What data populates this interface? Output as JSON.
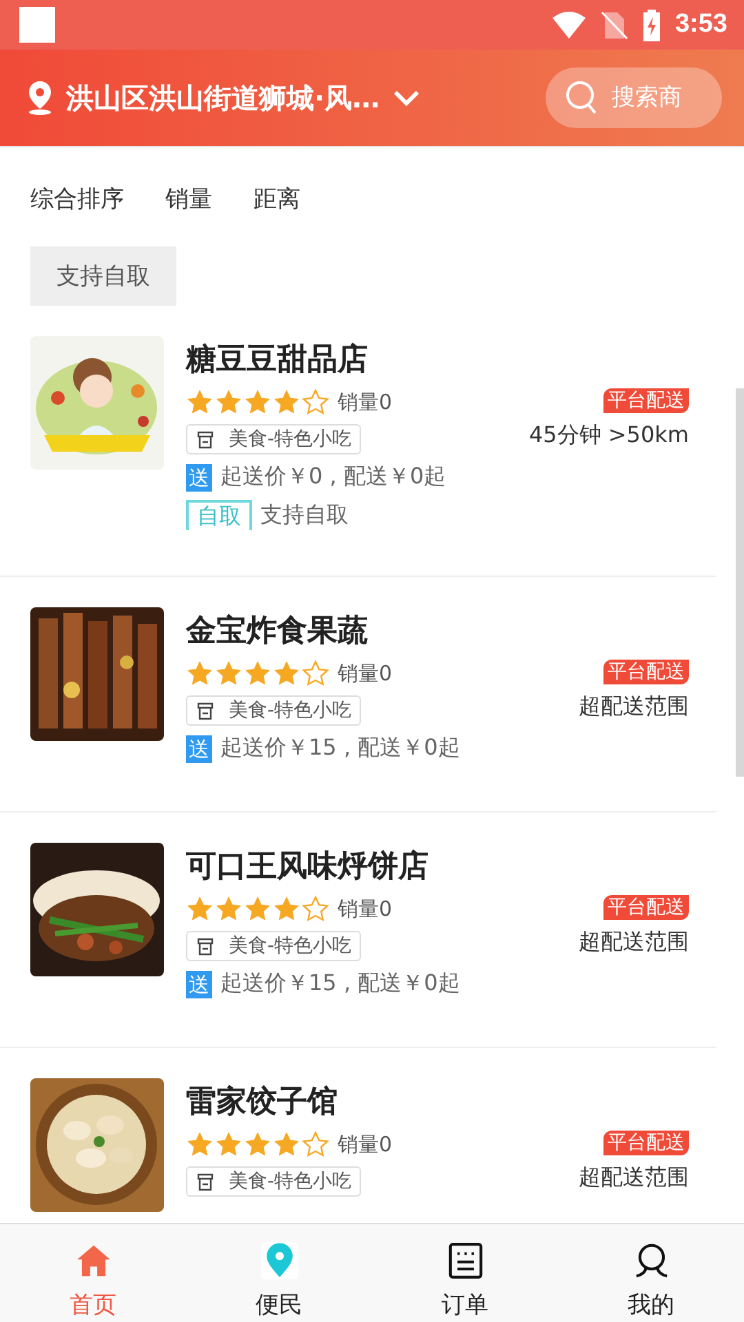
{
  "status_bar": {
    "time": "3:53"
  },
  "header": {
    "location": "洪山区洪山街道狮城·风…",
    "search": {
      "placeholder": "搜索商"
    }
  },
  "sort_tabs": [
    {
      "label": "综合排序",
      "selected": false
    },
    {
      "label": "销量",
      "selected": false
    },
    {
      "label": "距离",
      "selected": false
    }
  ],
  "filter_chips": [
    {
      "label": "支持自取",
      "selected": false
    }
  ],
  "shops": [
    {
      "name": "糖豆豆甜品店",
      "stars": 4,
      "sales": "销量0",
      "category": "美食-特色小吃",
      "delivery_tag": "送",
      "delivery": "起送价￥0 , 配送￥0起",
      "badge": "平台配送",
      "distance": "45分钟 >50km",
      "pickup_tag": "自取",
      "pickup": "支持自取"
    },
    {
      "name": "金宝炸食果蔬",
      "stars": 4,
      "sales": "销量0",
      "category": "美食-特色小吃",
      "delivery_tag": "送",
      "delivery": "起送价￥15 , 配送￥0起",
      "badge": "平台配送",
      "distance": "超配送范围"
    },
    {
      "name": "可口王风味烀饼店",
      "stars": 4,
      "sales": "销量0",
      "category": "美食-特色小吃",
      "delivery_tag": "送",
      "delivery": "起送价￥15 , 配送￥0起",
      "badge": "平台配送",
      "distance": "超配送范围"
    },
    {
      "name": "雷家饺子馆",
      "stars": 4,
      "sales": "销量0",
      "category": "美食-特色小吃",
      "badge": "平台配送",
      "distance": "超配送范围"
    }
  ],
  "bottom_nav": [
    {
      "label": "首页",
      "kind": "home",
      "selected": true
    },
    {
      "label": "便民",
      "kind": "pin",
      "selected": false
    },
    {
      "label": "订单",
      "kind": "orders",
      "selected": false
    },
    {
      "label": "我的",
      "kind": "profile",
      "selected": false
    }
  ]
}
